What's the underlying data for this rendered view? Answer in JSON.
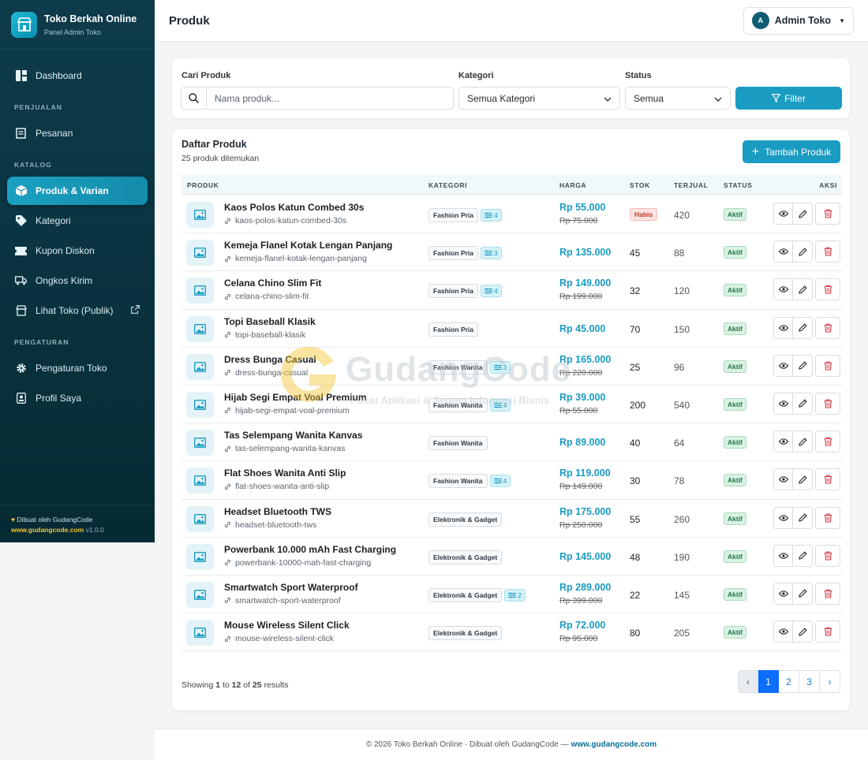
{
  "brand": {
    "title": "Toko Berkah Online",
    "subtitle": "Panel Admin Toko"
  },
  "sidebar": {
    "dashboard": "Dashboard",
    "sections": {
      "penjualan": "PENJUALAN",
      "katalog": "KATALOG",
      "pengaturan": "PENGATURAN"
    },
    "items": {
      "pesanan": "Pesanan",
      "produk": "Produk & Varian",
      "kategori": "Kategori",
      "kupon": "Kupon Diskon",
      "ongkir": "Ongkos Kirim",
      "lihat_toko": "Lihat Toko (Publik)",
      "pengaturan_toko": "Pengaturan Toko",
      "profil": "Profil Saya"
    },
    "footer": {
      "credit": "Dibuat oleh GudangCode",
      "url": "www.gudangcode.com",
      "version": "v1.0.0"
    }
  },
  "header": {
    "title": "Produk",
    "user_initial": "A",
    "user_name": "Admin Toko"
  },
  "filter": {
    "search_label": "Cari Produk",
    "search_placeholder": "Nama produk...",
    "category_label": "Kategori",
    "category_value": "Semua Kategori",
    "status_label": "Status",
    "status_value": "Semua",
    "button": "Filter"
  },
  "list": {
    "title": "Daftar Produk",
    "count": "25 produk ditemukan",
    "add_button": "Tambah Produk",
    "columns": {
      "produk": "PRODUK",
      "kategori": "KATEGORI",
      "harga": "HARGA",
      "stok": "STOK",
      "terjual": "TERJUAL",
      "status": "STATUS",
      "aksi": "AKSI"
    },
    "rows": [
      {
        "name": "Kaos Polos Katun Combed 30s",
        "slug": "kaos-polos-katun-combed-30s",
        "category": "Fashion Pria",
        "variants": "4",
        "price": "Rp 55.000",
        "old_price": "Rp 75.000",
        "stock": "Habis",
        "sold": "420",
        "status": "Aktif"
      },
      {
        "name": "Kemeja Flanel Kotak Lengan Panjang",
        "slug": "kemeja-flanel-kotak-lengan-panjang",
        "category": "Fashion Pria",
        "variants": "3",
        "price": "Rp 135.000",
        "old_price": "",
        "stock": "45",
        "sold": "88",
        "status": "Aktif"
      },
      {
        "name": "Celana Chino Slim Fit",
        "slug": "celana-chino-slim-fit",
        "category": "Fashion Pria",
        "variants": "4",
        "price": "Rp 149.000",
        "old_price": "Rp 199.000",
        "stock": "32",
        "sold": "120",
        "status": "Aktif"
      },
      {
        "name": "Topi Baseball Klasik",
        "slug": "topi-baseball-klasik",
        "category": "Fashion Pria",
        "variants": "",
        "price": "Rp 45.000",
        "old_price": "",
        "stock": "70",
        "sold": "150",
        "status": "Aktif"
      },
      {
        "name": "Dress Bunga Casual",
        "slug": "dress-bunga-casual",
        "category": "Fashion Wanita",
        "variants": "3",
        "price": "Rp 165.000",
        "old_price": "Rp 220.000",
        "stock": "25",
        "sold": "96",
        "status": "Aktif"
      },
      {
        "name": "Hijab Segi Empat Voal Premium",
        "slug": "hijab-segi-empat-voal-premium",
        "category": "Fashion Wanita",
        "variants": "4",
        "price": "Rp 39.000",
        "old_price": "Rp 55.000",
        "stock": "200",
        "sold": "540",
        "status": "Aktif"
      },
      {
        "name": "Tas Selempang Wanita Kanvas",
        "slug": "tas-selempang-wanita-kanvas",
        "category": "Fashion Wanita",
        "variants": "",
        "price": "Rp 89.000",
        "old_price": "",
        "stock": "40",
        "sold": "64",
        "status": "Aktif"
      },
      {
        "name": "Flat Shoes Wanita Anti Slip",
        "slug": "flat-shoes-wanita-anti-slip",
        "category": "Fashion Wanita",
        "variants": "4",
        "price": "Rp 119.000",
        "old_price": "Rp 149.000",
        "stock": "30",
        "sold": "78",
        "status": "Aktif"
      },
      {
        "name": "Headset Bluetooth TWS",
        "slug": "headset-bluetooth-tws",
        "category": "Elektronik & Gadget",
        "variants": "",
        "price": "Rp 175.000",
        "old_price": "Rp 250.000",
        "stock": "55",
        "sold": "260",
        "status": "Aktif"
      },
      {
        "name": "Powerbank 10.000 mAh Fast Charging",
        "slug": "powerbank-10000-mah-fast-charging",
        "category": "Elektronik & Gadget",
        "variants": "",
        "price": "Rp 145.000",
        "old_price": "",
        "stock": "48",
        "sold": "190",
        "status": "Aktif"
      },
      {
        "name": "Smartwatch Sport Waterproof",
        "slug": "smartwatch-sport-waterproof",
        "category": "Elektronik & Gadget",
        "variants": "2",
        "price": "Rp 289.000",
        "old_price": "Rp 399.000",
        "stock": "22",
        "sold": "145",
        "status": "Aktif"
      },
      {
        "name": "Mouse Wireless Silent Click",
        "slug": "mouse-wireless-silent-click",
        "category": "Elektronik & Gadget",
        "variants": "",
        "price": "Rp 72.000",
        "old_price": "Rp 95.000",
        "stock": "80",
        "sold": "205",
        "status": "Aktif"
      }
    ],
    "showing": {
      "prefix": "Showing",
      "from": "1",
      "to_word": "to",
      "to": "12",
      "of_word": "of",
      "total": "25",
      "suffix": "results"
    },
    "pagination": {
      "prev": "‹",
      "pages": [
        "1",
        "2",
        "3"
      ],
      "next": "›"
    }
  },
  "footer": {
    "text": "© 2026 Toko Berkah Online · Dibuat oleh GudangCode —",
    "link": "www.gudangcode.com"
  },
  "watermark": {
    "name": "GudangCode",
    "tagline": "Pusat Aplikasi & Sistem Informasi Bisnis"
  },
  "colors": {
    "accent": "#1a9cc2",
    "sidebar": "#0a3440",
    "danger": "#dc3545",
    "success": "#1e7a46"
  }
}
